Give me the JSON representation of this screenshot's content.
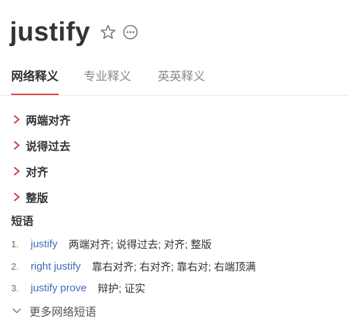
{
  "header": {
    "word": "justify",
    "icons": [
      "star-outline-icon",
      "more-circle-icon"
    ]
  },
  "tabs": [
    {
      "label": "网络释义",
      "active": true
    },
    {
      "label": "专业释义",
      "active": false
    },
    {
      "label": "英英释义",
      "active": false
    }
  ],
  "definitions": [
    {
      "label": "两端对齐"
    },
    {
      "label": "说得过去"
    },
    {
      "label": "对齐"
    },
    {
      "label": "整版"
    }
  ],
  "phrases_title": "短语",
  "phrases": [
    {
      "num": "1.",
      "en": "justify",
      "cn": "两端对齐;  说得过去;  对齐;  整版"
    },
    {
      "num": "2.",
      "en": "right justify",
      "cn": "靠右对齐;  右对齐;  靠右对;  右端顶满"
    },
    {
      "num": "3.",
      "en": "justify prove",
      "cn": "辩护;  证实"
    }
  ],
  "more_label": "更多网络短语",
  "colors": {
    "accent": "#e5403d",
    "link": "#3a6db6",
    "chevron": "#d03a3a"
  }
}
